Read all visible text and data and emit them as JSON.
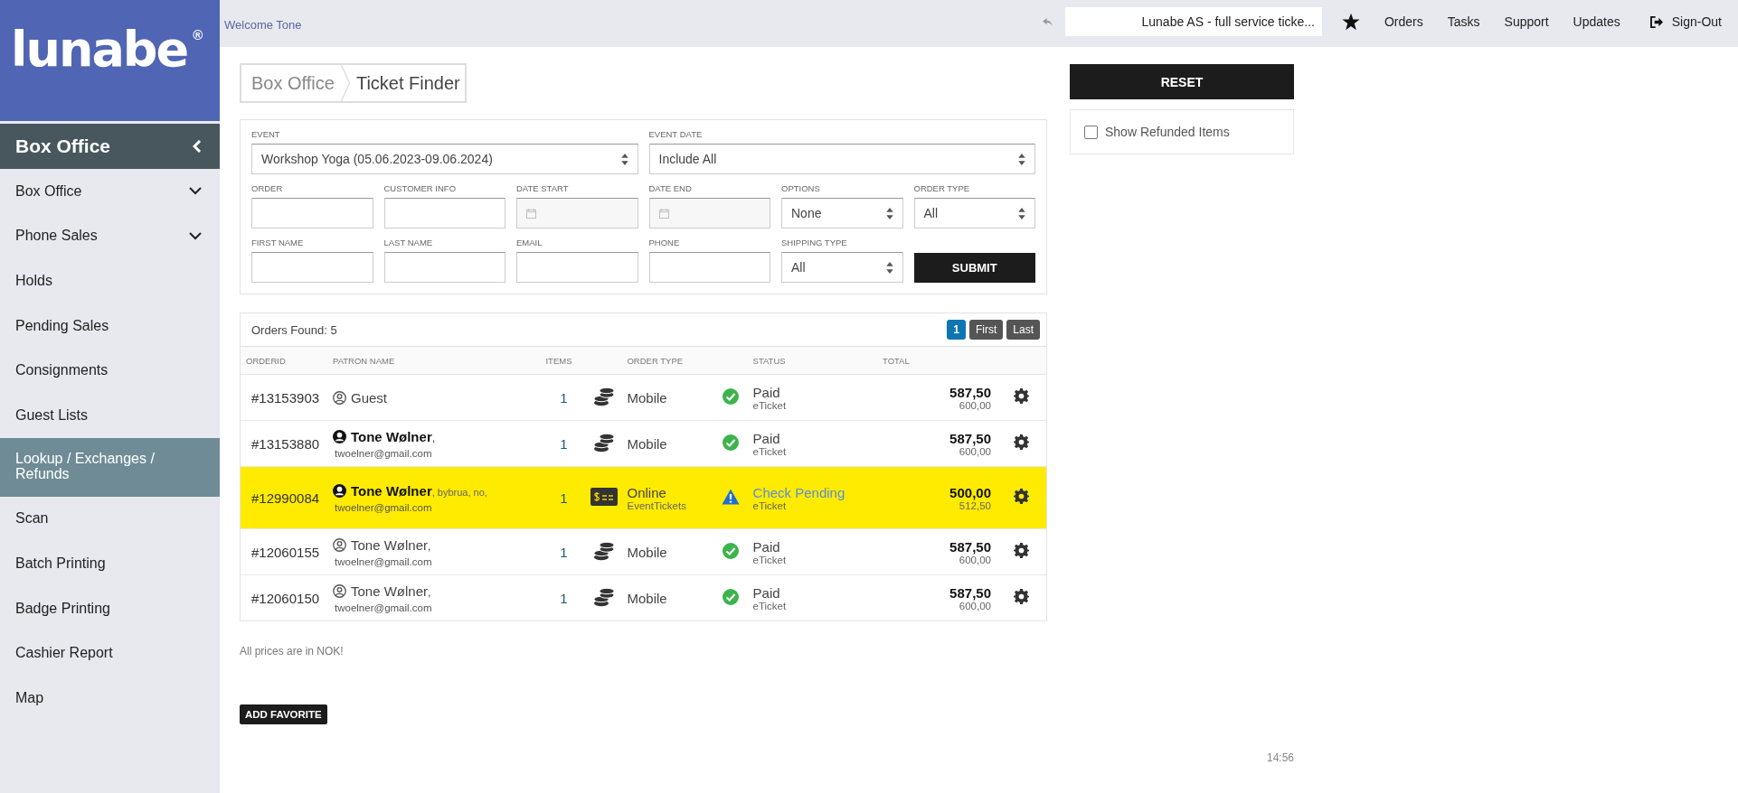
{
  "logo": {
    "text": "lunabe",
    "mark": "®"
  },
  "sidebar": {
    "title": "Box Office",
    "items": [
      {
        "label": "Box Office",
        "expandable": true,
        "selected": false
      },
      {
        "label": "Phone Sales",
        "expandable": true,
        "selected": false
      },
      {
        "label": "Holds",
        "expandable": false,
        "selected": false
      },
      {
        "label": "Pending Sales",
        "expandable": false,
        "selected": false
      },
      {
        "label": "Consignments",
        "expandable": false,
        "selected": false
      },
      {
        "label": "Guest Lists",
        "expandable": false,
        "selected": false
      },
      {
        "label": "Lookup / Exchanges / Refunds",
        "expandable": false,
        "selected": true
      },
      {
        "label": "Scan",
        "expandable": false,
        "selected": false
      },
      {
        "label": "Batch Printing",
        "expandable": false,
        "selected": false
      },
      {
        "label": "Badge Printing",
        "expandable": false,
        "selected": false
      },
      {
        "label": "Cashier Report",
        "expandable": false,
        "selected": false
      },
      {
        "label": "Map",
        "expandable": false,
        "selected": false
      }
    ]
  },
  "topbar": {
    "welcome": "Welcome Tone",
    "account": "Lunabe AS - full service ticke...",
    "links": [
      "Orders",
      "Tasks",
      "Support",
      "Updates"
    ],
    "sign_out": "Sign-Out"
  },
  "breadcrumb": [
    "Box Office",
    "Ticket Finder"
  ],
  "filters": {
    "event_fields": [
      {
        "label": "EVENT",
        "value": "Workshop Yoga (05.06.2023-09.06.2024)"
      },
      {
        "label": "EVENT DATE",
        "value": "Include All"
      }
    ],
    "rows": [
      [
        {
          "kind": "text",
          "label": "ORDER"
        },
        {
          "kind": "text",
          "label": "CUSTOMER INFO"
        },
        {
          "kind": "date",
          "label": "DATE START"
        },
        {
          "kind": "date",
          "label": "DATE END"
        },
        {
          "kind": "select",
          "label": "OPTIONS",
          "value": "None"
        },
        {
          "kind": "select",
          "label": "ORDER TYPE",
          "value": "All"
        }
      ],
      [
        {
          "kind": "text",
          "label": "FIRST NAME"
        },
        {
          "kind": "text",
          "label": "LAST NAME"
        },
        {
          "kind": "text",
          "label": "EMAIL"
        },
        {
          "kind": "text",
          "label": "PHONE"
        },
        {
          "kind": "select",
          "label": "SHIPPING TYPE",
          "value": "All"
        },
        {
          "kind": "button",
          "label": "SUBMIT"
        }
      ]
    ]
  },
  "reset_button": "RESET",
  "show_refunded": {
    "label": "Show Refunded Items",
    "checked": false
  },
  "orders": {
    "found": "Orders Found: 5",
    "pages": [
      {
        "label": "1",
        "selected": true
      }
    ],
    "nav": [
      "First",
      "Last"
    ],
    "columns": [
      "ORDERID",
      "PATRON NAME",
      "ITEMS",
      "ORDER TYPE",
      "STATUS",
      "TOTAL"
    ],
    "rows": [
      {
        "id": "#13153903",
        "patron": {
          "name": "Guest",
          "registered": false
        },
        "items": "1",
        "kind": "cash",
        "order_type": "Mobile",
        "status": {
          "kind": "paid",
          "label": "Paid",
          "sub": "eTicket"
        },
        "total": "587,50",
        "subtotal": "600,00",
        "highlighted": false
      },
      {
        "id": "#13153880",
        "patron": {
          "name": "Tone Wølner",
          "registered": true,
          "details": ",",
          "email": "twoelner@gmail.com"
        },
        "items": "1",
        "kind": "cash",
        "order_type": "Mobile",
        "status": {
          "kind": "paid",
          "label": "Paid",
          "sub": "eTicket"
        },
        "total": "587,50",
        "subtotal": "600,00",
        "highlighted": false
      },
      {
        "id": "#12990084",
        "patron": {
          "name": "Tone Wølner",
          "registered": true,
          "details": ", bybrua, no,",
          "email": "twoelner@gmail.com"
        },
        "items": "1",
        "kind": "card",
        "order_type": "Online",
        "order_sub": "EventTickets",
        "status": {
          "kind": "pending",
          "label": "Check Pending",
          "sub": "eTicket"
        },
        "total": "500,00",
        "subtotal": "512,50",
        "highlighted": true
      },
      {
        "id": "#12060155",
        "patron": {
          "name": "Tone Wølner",
          "registered": false,
          "details": ",",
          "email": "twoelner@gmail.com"
        },
        "items": "1",
        "kind": "cash",
        "order_type": "Mobile",
        "status": {
          "kind": "paid",
          "label": "Paid",
          "sub": "eTicket"
        },
        "total": "587,50",
        "subtotal": "600,00",
        "highlighted": false
      },
      {
        "id": "#12060150",
        "patron": {
          "name": "Tone Wølner",
          "registered": false,
          "details": ",",
          "email": "twoelner@gmail.com"
        },
        "items": "1",
        "kind": "cash",
        "order_type": "Mobile",
        "status": {
          "kind": "paid",
          "label": "Paid",
          "sub": "eTicket"
        },
        "total": "587,50",
        "subtotal": "600,00",
        "highlighted": false
      }
    ]
  },
  "note": "All prices are in NOK!",
  "favorite_button": "ADD FAVORITE",
  "time": "14:56"
}
